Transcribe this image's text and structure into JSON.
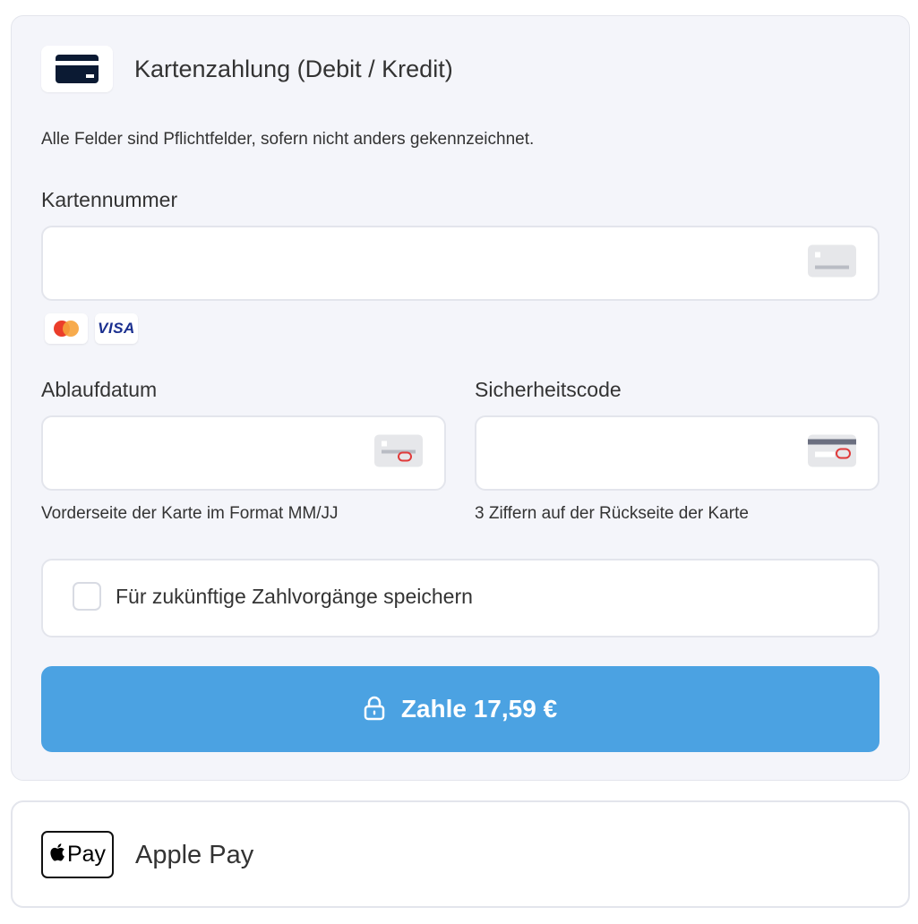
{
  "card_payment": {
    "title": "Kartenzahlung (Debit / Kredit)",
    "required_note": "Alle Felder sind Pflichtfelder, sofern nicht anders gekennzeichnet.",
    "card_number": {
      "label": "Kartennummer",
      "value": "",
      "placeholder": ""
    },
    "brands": [
      "mastercard-icon",
      "VISA"
    ],
    "expiry": {
      "label": "Ablaufdatum",
      "value": "",
      "placeholder": "",
      "hint": "Vorderseite der Karte im Format MM/JJ"
    },
    "cvc": {
      "label": "Sicherheitscode",
      "value": "",
      "placeholder": "",
      "hint": "3 Ziffern auf der Rückseite der Karte"
    },
    "save_label": "Für zukünftige Zahlvorgänge speichern",
    "save_checked": false,
    "pay_button_label": "Zahle 17,59 €",
    "accent_color": "#4ba2e2"
  },
  "apple_pay": {
    "badge_text": "Pay",
    "label": "Apple Pay"
  }
}
